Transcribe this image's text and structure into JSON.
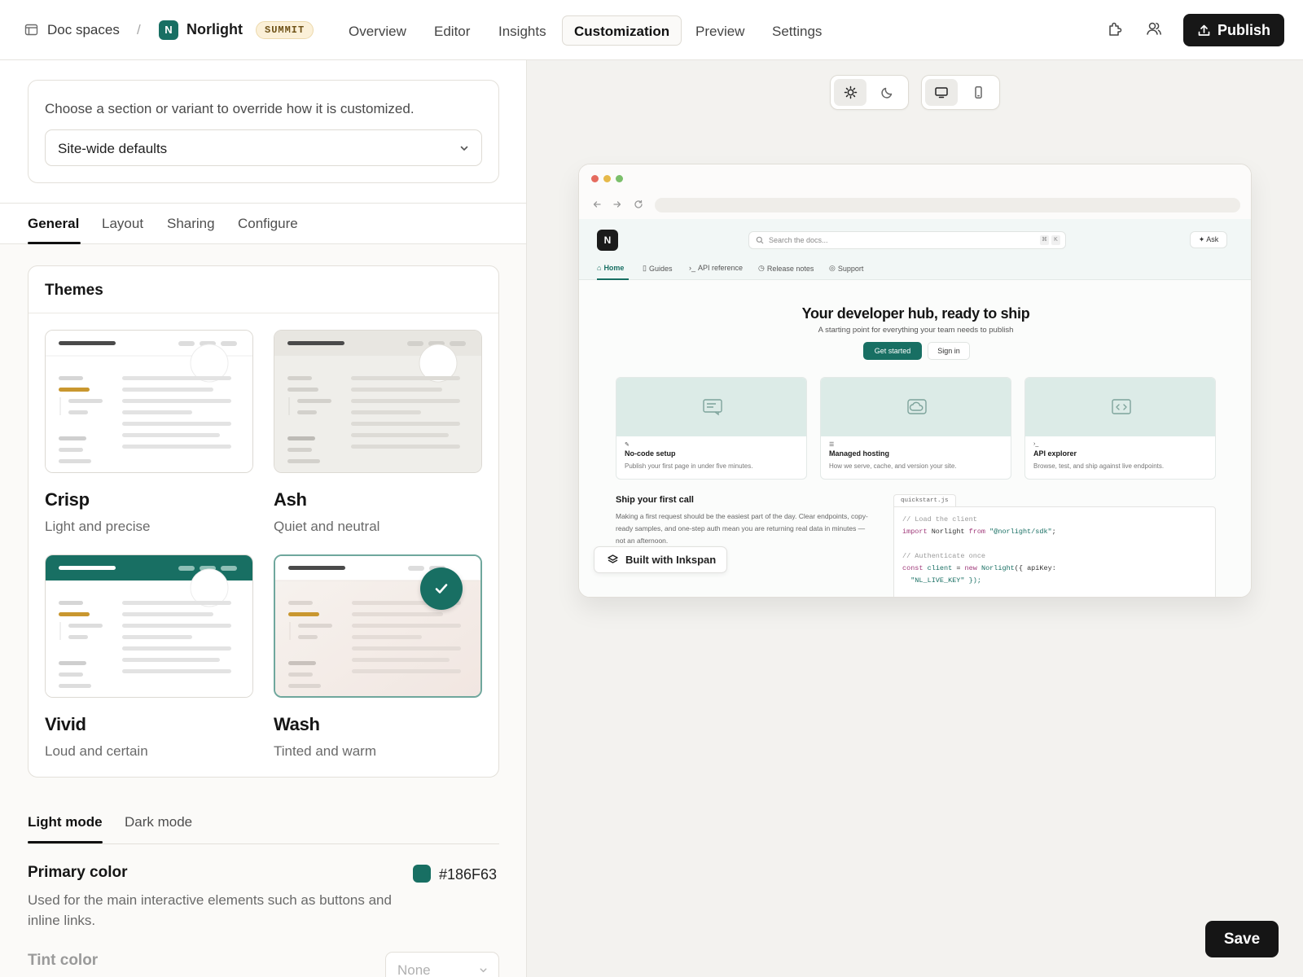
{
  "header": {
    "breadcrumb_root": "Doc spaces",
    "breadcrumb_sep": "/",
    "logo_letter": "N",
    "project_name": "Norlight",
    "badge": "SUMMIT",
    "tabs": [
      {
        "label": "Overview",
        "active": false
      },
      {
        "label": "Editor",
        "active": false
      },
      {
        "label": "Insights",
        "active": false
      },
      {
        "label": "Customization",
        "active": true
      },
      {
        "label": "Preview",
        "active": false
      },
      {
        "label": "Settings",
        "active": false
      }
    ],
    "icons": [
      "extension-icon",
      "users-icon"
    ],
    "publish_label": "Publish"
  },
  "override": {
    "prompt": "Choose a section or variant to override how it is customized.",
    "selected": "Site-wide defaults"
  },
  "subtabs": [
    {
      "label": "General",
      "active": true
    },
    {
      "label": "Layout",
      "active": false
    },
    {
      "label": "Sharing",
      "active": false
    },
    {
      "label": "Configure",
      "active": false
    }
  ],
  "themes": {
    "title": "Themes",
    "items": [
      {
        "name": "Crisp",
        "desc": "Light and precise",
        "selected": false
      },
      {
        "name": "Ash",
        "desc": "Quiet and neutral",
        "selected": false
      },
      {
        "name": "Vivid",
        "desc": "Loud and certain",
        "selected": false
      },
      {
        "name": "Wash",
        "desc": "Tinted and warm",
        "selected": true
      }
    ]
  },
  "mode_tabs": [
    {
      "label": "Light mode",
      "active": true
    },
    {
      "label": "Dark mode",
      "active": false
    }
  ],
  "primary_color": {
    "title": "Primary color",
    "desc": "Used for the main interactive elements such as buttons and inline links.",
    "value": "#186F63"
  },
  "tint_color": {
    "title": "Tint color",
    "value": "None"
  },
  "colors": {
    "accent": "#186F63",
    "publish_bg": "#171717",
    "badge_bg": "#FBF0D8"
  },
  "preview": {
    "theme_toggle": {
      "light": true,
      "dark": false
    },
    "device_toggle": {
      "desktop": true,
      "mobile": false
    },
    "site": {
      "logo_letter": "N",
      "search_placeholder": "Search the docs...",
      "search_kbd": [
        "⌘",
        "K"
      ],
      "ask_label": "Ask",
      "nav": [
        {
          "label": "Home",
          "active": true
        },
        {
          "label": "Guides",
          "active": false
        },
        {
          "label": "API reference",
          "active": false
        },
        {
          "label": "Release notes",
          "active": false
        },
        {
          "label": "Support",
          "active": false
        }
      ],
      "hero_title": "Your developer hub, ready to ship",
      "hero_subtitle": "A starting point for everything your team needs to publish",
      "cta_primary": "Get started",
      "cta_secondary": "Sign in",
      "cards": [
        {
          "title": "No-code setup",
          "desc": "Publish your first page in under five minutes."
        },
        {
          "title": "Managed hosting",
          "desc": "How we serve, cache, and version your site."
        },
        {
          "title": "API explorer",
          "desc": "Browse, test, and ship against live endpoints."
        }
      ],
      "ship_title": "Ship your first call",
      "ship_desc": "Making a first request should be the easiest part of the day. Clear endpoints, copy-ready samples, and one-step auth mean you are returning real data in minutes — not an afternoon.",
      "code_file": "quickstart.js",
      "code_lines": [
        "// Load the client",
        "import Norlight from \"@norlight/sdk\";",
        "",
        "// Authenticate once",
        "const client = new Norlight({ apiKey:",
        "  \"NL_LIVE_KEY\" });"
      ]
    },
    "built_with": "Built with Inkspan"
  },
  "save_label": "Save"
}
